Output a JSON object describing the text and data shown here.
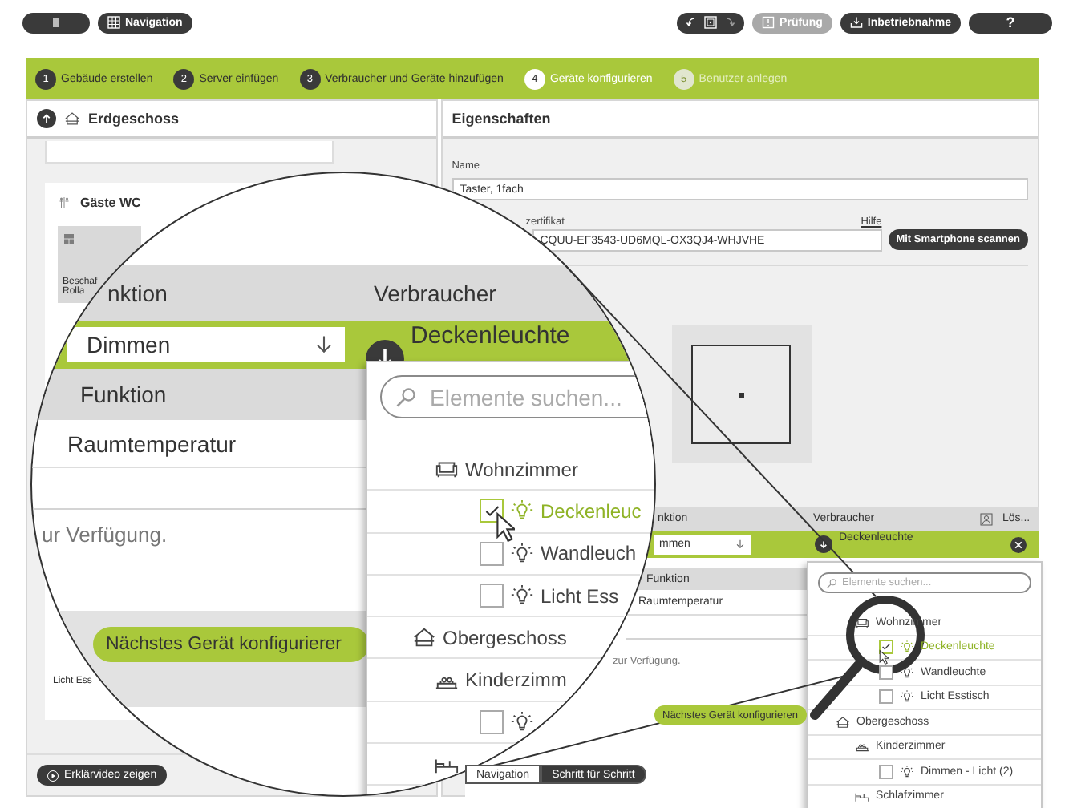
{
  "toolbar": {
    "navigation_button": "Navigation",
    "check_button": {
      "label": "Prüfung",
      "disabled": true
    },
    "commission_button": "Inbetriebnahme",
    "help_button": "?"
  },
  "steps": [
    {
      "number": "1",
      "label": "Gebäude erstellen",
      "selected": false,
      "disabled": false
    },
    {
      "number": "2",
      "label": "Server einfügen",
      "selected": false,
      "disabled": false
    },
    {
      "number": "3",
      "label": "Verbraucher und Geräte hinzufügen",
      "selected": false,
      "disabled": false
    },
    {
      "number": "4",
      "label": "Geräte konfigurieren",
      "selected": true,
      "disabled": false
    },
    {
      "number": "5",
      "label": "Benutzer anlegen",
      "selected": false,
      "disabled": true
    }
  ],
  "floor_panel": {
    "title": "Erdgeschoss",
    "room_title": "Gäste WC",
    "tile_lines": [
      "Beschaf",
      "Rolla"
    ],
    "second_tile_label": "Licht Ess",
    "video_button": "Erklärvideo zeigen"
  },
  "properties": {
    "title": "Eigenschaften",
    "name_label": "Name",
    "name_value": "Taster, 1fach",
    "certificate_label": "zertifikat",
    "help_link": "Hilfe",
    "certificate_value": "CQUU-EF3543-UD6MQL-OX3QJ4-WHJVHE",
    "scan_button": "Mit Smartphone scannen"
  },
  "inset": {
    "headers": [
      "nktion",
      "Verbraucher",
      "Lös..."
    ],
    "function_value": "mmen",
    "consumer": "Deckenleuchte",
    "row2_header": "Funktion",
    "row2_value": "Raumtemperatur",
    "note": "zur Verfügung.",
    "next_button": "Nächstes Gerät konfigurieren",
    "mode_toggle": [
      {
        "label": "Navigation",
        "selected": false
      },
      {
        "label": "Schritt für Schritt",
        "selected": true
      }
    ],
    "dropdown": {
      "placeholder": "Elemente suchen...",
      "tree": [
        {
          "kind": "livingroom",
          "label": "Wohnzimmer",
          "children": [
            {
              "kind": "light",
              "label": "Deckenleuchte",
              "checked": true
            },
            {
              "kind": "light",
              "label": "Wandleuchte",
              "checked": false
            },
            {
              "kind": "light",
              "label": "Licht Esstisch",
              "checked": false
            }
          ]
        },
        {
          "kind": "floor",
          "label": "Obergeschoss",
          "children": [
            {
              "kind": "kidsroom",
              "label": "Kinderzimmer",
              "children": [
                {
                  "kind": "light",
                  "label": "Dimmen - Licht (2)",
                  "checked": false
                }
              ]
            },
            {
              "kind": "bedroom",
              "label": "Schlafzimmer"
            }
          ]
        }
      ]
    }
  },
  "magnifier": {
    "headers": [
      "nktion",
      "Verbraucher"
    ],
    "function_value": "Dimmen",
    "consumer": "Deckenleuchte",
    "row2_header": "Funktion",
    "row2_value": "Raumtemperatur",
    "note": "ur Verfügung.",
    "next_button": "Nächstes Gerät konfigurierer",
    "dropdown": {
      "placeholder": "Elemente suchen...",
      "tree": [
        {
          "kind": "livingroom",
          "label": "Wohnzimmer",
          "children": [
            {
              "kind": "light",
              "label": "Deckenleuc",
              "checked": true
            },
            {
              "kind": "light",
              "label": "Wandleuch",
              "checked": false
            },
            {
              "kind": "light",
              "label": "Licht Ess",
              "checked": false
            }
          ]
        },
        {
          "kind": "floor",
          "label": "Obergeschoss",
          "children": [
            {
              "kind": "kidsroom",
              "label": "Kinderzimm",
              "children": [
                {
                  "kind": "light",
                  "checked": false
                }
              ]
            },
            {
              "kind": "bedroom"
            }
          ]
        }
      ]
    }
  }
}
